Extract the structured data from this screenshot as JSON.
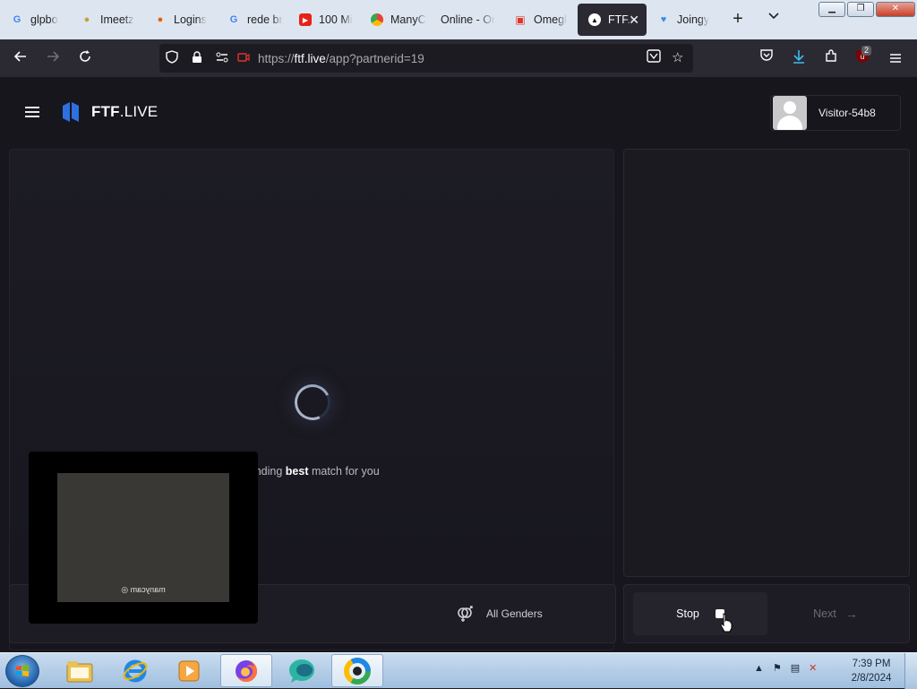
{
  "browser": {
    "tabs": [
      {
        "title": "glpbo",
        "icon": "google-icon"
      },
      {
        "title": "Imeetz",
        "icon": "chat-bubbles-icon"
      },
      {
        "title": "Logins",
        "icon": "firefox-icon"
      },
      {
        "title": "rede br",
        "icon": "google-icon"
      },
      {
        "title": "100 Mi",
        "icon": "youtube-icon"
      },
      {
        "title": "ManyC",
        "icon": "manycam-icon"
      },
      {
        "title": "Online - Or",
        "icon": "blank-icon"
      },
      {
        "title": "Omegl",
        "icon": "video-camera-icon"
      },
      {
        "title": "FTF.l",
        "icon": "triangle-logo-icon",
        "active": true
      },
      {
        "title": "Joingy",
        "icon": "joingy-icon"
      }
    ],
    "url_prefix": "https://",
    "url_domain": "ftf.live",
    "url_path": "/app?partnerid=19",
    "extension_badge": "2"
  },
  "header": {
    "brand_bold": "FTF",
    "brand_rest": ".LIVE",
    "username": "Visitor-54b8"
  },
  "stage": {
    "status_pre": "Finding ",
    "status_bold": "best",
    "status_post": " match for you"
  },
  "selfcam": {
    "watermark": "manycam"
  },
  "controls": {
    "genders_label": "All Genders",
    "stop_label": "Stop",
    "next_label": "Next"
  },
  "taskbar": {
    "time": "7:39 PM",
    "date": "2/8/2024"
  },
  "colors": {
    "page_bg": "#17161d",
    "tab_active_bg": "#2b2a33",
    "accent_logo": "#2f6fe0"
  }
}
